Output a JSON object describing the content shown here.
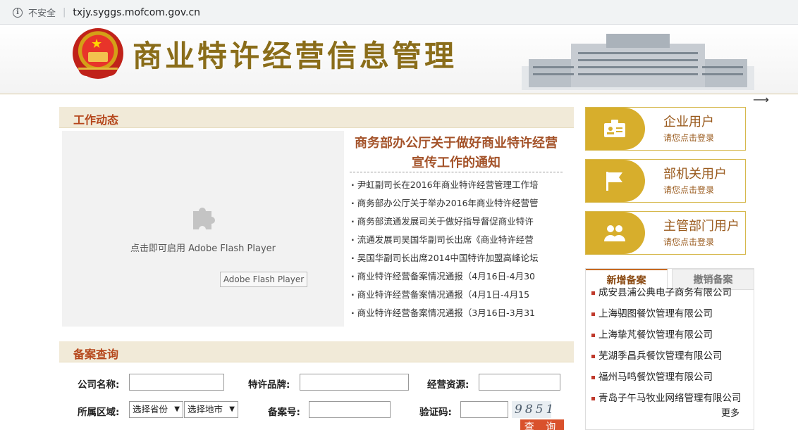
{
  "browser": {
    "security_label": "不安全",
    "url": "txjy.syggs.mofcom.gov.cn"
  },
  "site": {
    "title": "商业特许经营信息管理"
  },
  "news_section": {
    "title": "工作动态",
    "flash_text": "点击即可启用 Adobe Flash Player",
    "flash_button": "Adobe Flash Player",
    "headline": "商务部办公厅关于做好商业特许经营宣传工作的通知",
    "items": [
      "尹虹副司长在2016年商业特许经营管理工作培",
      "商务部办公厅关于举办2016年商业特许经营管",
      "商务部流通发展司关于做好指导督促商业特许",
      "流通发展司吴国华副司长出席《商业特许经营",
      "吴国华副司长出席2014中国特许加盟高峰论坛",
      "商业特许经营备案情况通报（4月16日-4月30",
      "商业特许经营备案情况通报（4月1日-4月15",
      "商业特许经营备案情况通报（3月16日-3月31"
    ]
  },
  "query_section": {
    "title": "备案查询",
    "company_label": "公司名称:",
    "brand_label": "特许品牌:",
    "resource_label": "经营资源:",
    "region_label": "所属区域:",
    "province_select": "选择省份",
    "city_select": "选择地市",
    "record_no_label": "备案号:",
    "captcha_label": "验证码:",
    "captcha_value": "9851",
    "query_button": "查 询"
  },
  "login": [
    {
      "title": "企业用户",
      "sub": "请您点击登录",
      "icon": "id-card-icon"
    },
    {
      "title": "部机关用户",
      "sub": "请您点击登录",
      "icon": "flag-icon"
    },
    {
      "title": "主管部门用户",
      "sub": "请您点击登录",
      "icon": "users-icon"
    }
  ],
  "records": {
    "tab_new": "新增备案",
    "tab_revoked": "撤销备案",
    "items": [
      "成安县浦公典电子商务有限公司",
      "上海驷图餐饮管理有限公司",
      "上海挚芃餐饮管理有限公司",
      "芜湖季昌兵餐饮管理有限公司",
      "福州马鸣餐饮管理有限公司",
      "青岛子午马牧业网络管理有限公司"
    ],
    "more": "更多"
  },
  "colors": {
    "title_gold": "#8a6d1a",
    "section_red": "#b5461b",
    "login_gold": "#d7ae2c",
    "button_orange": "#d9512c"
  }
}
